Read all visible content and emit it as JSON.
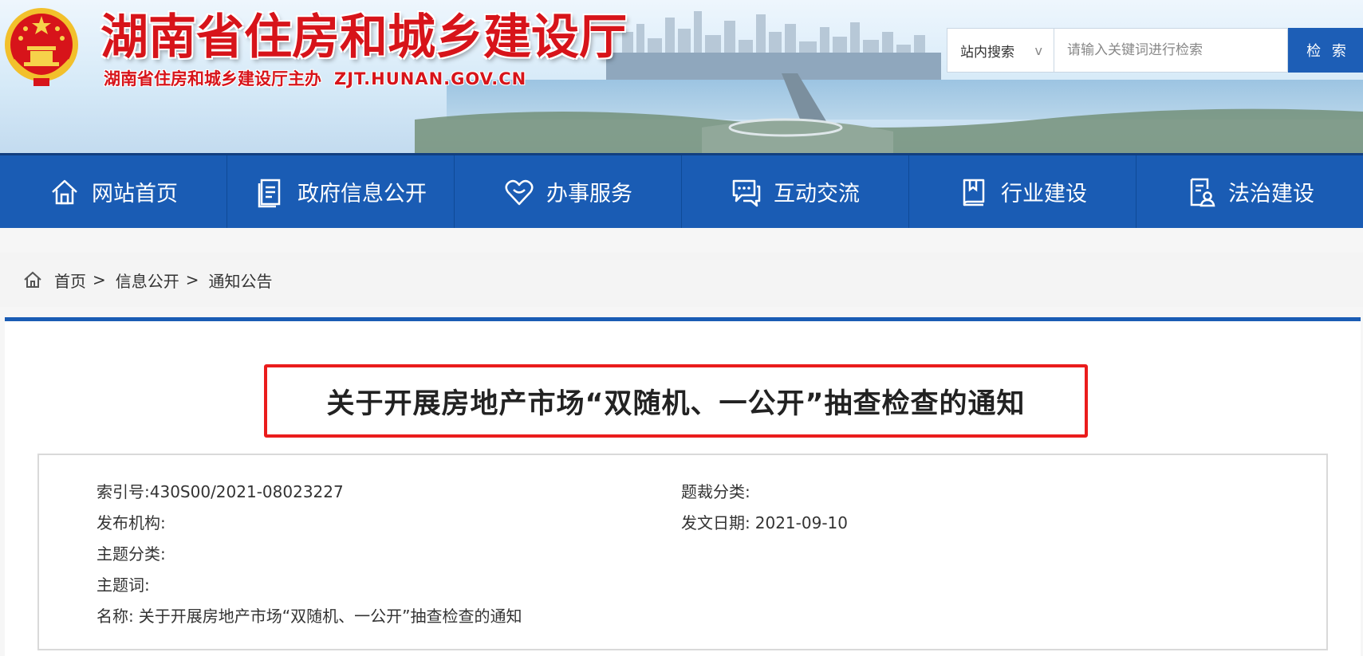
{
  "header": {
    "title": "湖南省住房和城乡建设厅",
    "subtitle": "湖南省住房和城乡建设厅主办",
    "domain": "ZJT.HUNAN.GOV.CN",
    "emblem_icon": "national-emblem-icon"
  },
  "search": {
    "scope_label": "站内搜索",
    "scope_chevron": "v",
    "placeholder": "请输入关键词进行检索",
    "button_label": "检 索"
  },
  "nav": {
    "items": [
      {
        "label": "网站首页",
        "icon": "home-icon"
      },
      {
        "label": "政府信息公开",
        "icon": "document-icon"
      },
      {
        "label": "办事服务",
        "icon": "heart-icon"
      },
      {
        "label": "互动交流",
        "icon": "chat-icon"
      },
      {
        "label": "行业建设",
        "icon": "book-icon"
      },
      {
        "label": "法治建设",
        "icon": "law-document-icon"
      }
    ]
  },
  "breadcrumb": {
    "items": [
      "首页",
      "信息公开",
      "通知公告"
    ],
    "separator": ">"
  },
  "article": {
    "title": "关于开展房地产市场“双随机、一公开”抽查检查的通知",
    "meta": {
      "index_label": "索引号:",
      "index_value": "430S00/2021-08023227",
      "genre_label": "题裁分类:",
      "genre_value": "",
      "publisher_label": "发布机构:",
      "publisher_value": "",
      "date_label": "发文日期:",
      "date_value": "2021-09-10",
      "topic_label": "主题分类:",
      "topic_value": "",
      "keywords_label": "主题词:",
      "keywords_value": "",
      "name_label": "名称:",
      "name_value": "关于开展房地产市场“双随机、一公开”抽查检查的通知"
    }
  },
  "colors": {
    "brand_red": "#d7141a",
    "nav_blue": "#1a5cb4",
    "highlight_red": "#ea1c1c"
  }
}
